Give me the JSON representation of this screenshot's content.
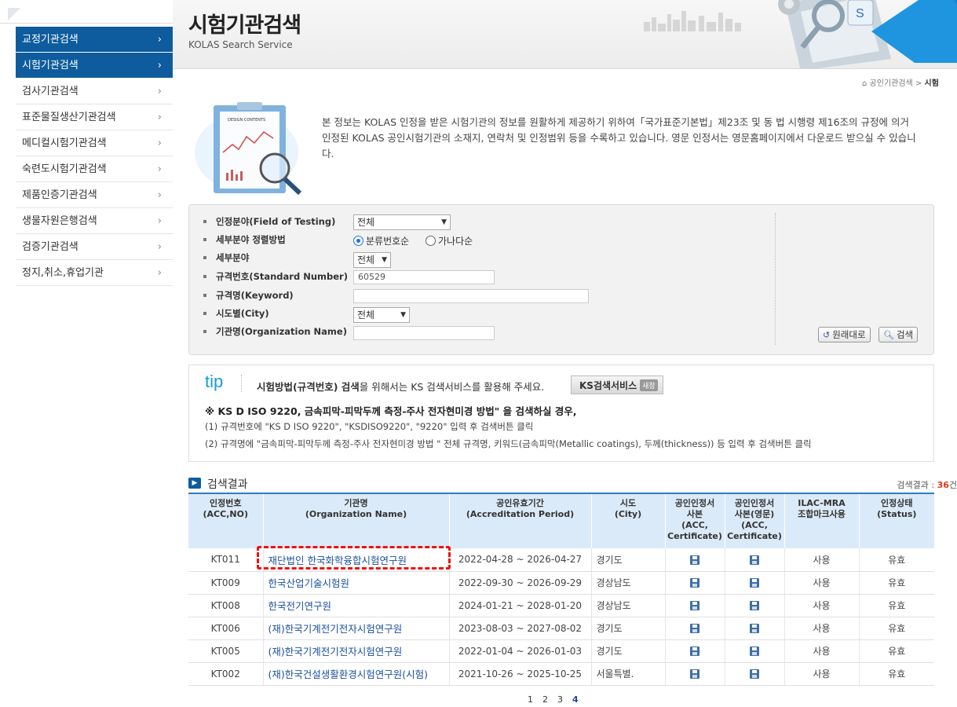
{
  "sidebar": {
    "items": [
      {
        "label": "교정기관검색",
        "active": true
      },
      {
        "label": "시험기관검색",
        "active": true
      },
      {
        "label": "검사기관검색",
        "active": false
      },
      {
        "label": "표준물질생산기관검색",
        "active": false
      },
      {
        "label": "메디컬시험기관검색",
        "active": false
      },
      {
        "label": "숙련도시험기관검색",
        "active": false
      },
      {
        "label": "제품인증기관검색",
        "active": false
      },
      {
        "label": "생물자원은행검색",
        "active": false
      },
      {
        "label": "검증기관검색",
        "active": false
      },
      {
        "label": "정지,취소,휴업기관",
        "active": false
      }
    ]
  },
  "header": {
    "title": "시험기관검색",
    "subtitle": "KOLAS Search Service"
  },
  "breadcrumb": {
    "home": "공인기관검색",
    "sep": ">",
    "current": "시험"
  },
  "intro": {
    "text": "본 정보는 KOLAS 인정을 받은 시험기관의 정보를 원활하게 제공하기 위하여「국가표준기본법」제23조 및 동 법 시행령 제16조의 규정에 의거 인정된 KOLAS 공인시험기관의 소재지, 연락처 및 인정범위 등을 수록하고 있습니다. 영문 인정서는 영문홈페이지에서 다운로드 받으실 수 있습니다.",
    "image_caption": "DESIGN CONTENTS"
  },
  "search": {
    "field_label": "인정분야(Field of Testing)",
    "field_value": "전체",
    "sort_label": "세부분야 정렬방법",
    "sort_opt1": "분류번호순",
    "sort_opt2": "가나다순",
    "sub_label": "세부분야",
    "sub_value": "전체",
    "std_label": "규격번호(Standard Number)",
    "std_value": "60529",
    "keyword_label": "규격명(Keyword)",
    "keyword_value": "",
    "city_label": "시도별(City)",
    "city_value": "전체",
    "org_label": "기관명(Organization Name)",
    "org_value": "",
    "reset_label": "원래대로",
    "search_label": "검색"
  },
  "tip": {
    "word": "tip",
    "line1_bold": "시험방법(규격번호) 검색",
    "line1_rest": "을 위해서는 KS 검색서비스를 활용해 주세요.",
    "ks_button": "KS검색서비스",
    "ks_badge": "새창",
    "line2": "※ KS D ISO 9220, 금속피막-피막두께 측정-주사 전자현미경 방법\" 을 검색하실 경우,",
    "line3": "(1) 규격번호에 \"KS D ISO 9220\", \"KSDISO9220\", \"9220\" 입력 후 검색버튼 클릭",
    "line4": "(2) 규격명에 \"금속피막-피막두께 측정-주사 전자현미경 방법 \" 전체 규격명, 키워드(금속피막(Metallic coatings), 두께(thickness)) 등 입력 후 검색버튼 클릭"
  },
  "results": {
    "title": "검색결과",
    "count_label": "검색결과 : ",
    "count": "36",
    "count_unit": "건",
    "columns": [
      {
        "l1": "인정번호",
        "l2": "(ACC,NO)",
        "l3": "",
        "l4": ""
      },
      {
        "l1": "기관명",
        "l2": "(Organization Name)",
        "l3": "",
        "l4": ""
      },
      {
        "l1": "공인유효기간",
        "l2": "(Accreditation Period)",
        "l3": "",
        "l4": ""
      },
      {
        "l1": "시도",
        "l2": "(City)",
        "l3": "",
        "l4": ""
      },
      {
        "l1": "공인인정서",
        "l2": "사본",
        "l3": "(ACC,",
        "l4": "Certificate)"
      },
      {
        "l1": "공인인정서",
        "l2": "사본(영문)",
        "l3": "(ACC,",
        "l4": "Certificate)"
      },
      {
        "l1": "ILAC-MRA",
        "l2": "조합마크사용",
        "l3": "",
        "l4": ""
      },
      {
        "l1": "인정상태",
        "l2": "(Status)",
        "l3": "",
        "l4": ""
      }
    ],
    "rows": [
      {
        "acc": "KT011",
        "org": "재단법인 한국화학융합시험연구원",
        "period": "2022-04-28 ~ 2026-04-27",
        "city": "경기도",
        "mra": "사용",
        "status": "유효"
      },
      {
        "acc": "KT009",
        "org": "한국산업기술시험원",
        "period": "2022-09-30 ~ 2026-09-29",
        "city": "경상남도",
        "mra": "사용",
        "status": "유효"
      },
      {
        "acc": "KT008",
        "org": "한국전기연구원",
        "period": "2024-01-21 ~ 2028-01-20",
        "city": "경상남도",
        "mra": "사용",
        "status": "유효"
      },
      {
        "acc": "KT006",
        "org": "(재)한국기계전기전자시험연구원",
        "period": "2023-08-03 ~ 2027-08-02",
        "city": "경기도",
        "mra": "사용",
        "status": "유효"
      },
      {
        "acc": "KT005",
        "org": "(재)한국기계전기전자시험연구원",
        "period": "2022-01-04 ~ 2026-01-03",
        "city": "경기도",
        "mra": "사용",
        "status": "유효"
      },
      {
        "acc": "KT002",
        "org": "(재)한국건설생활환경시험연구원(시험)",
        "period": "2021-10-26 ~ 2025-10-25",
        "city": "서울특별.",
        "mra": "사용",
        "status": "유효"
      }
    ]
  },
  "pagination": {
    "pages": [
      "1",
      "2",
      "3",
      "4"
    ],
    "current": "4"
  },
  "colors": {
    "accent": "#0e5c9e",
    "table_header": "#dbeaf8",
    "link": "#1a4f9c",
    "highlight": "#ee1111",
    "count": "#e03a1e",
    "tip": "#1a9bd7"
  }
}
